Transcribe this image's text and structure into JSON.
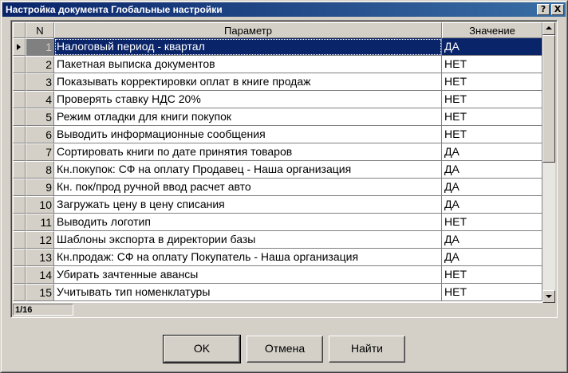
{
  "window": {
    "title": "Настройка документа Глобальные настройки",
    "help_label": "?",
    "close_label": "X"
  },
  "grid": {
    "columns": {
      "n": "N",
      "parameter": "Параметр",
      "value": "Значение"
    },
    "rows": [
      {
        "n": "1",
        "parameter": "Налоговый период - квартал",
        "value": "ДА"
      },
      {
        "n": "2",
        "parameter": "Пакетная выписка документов",
        "value": "НЕТ"
      },
      {
        "n": "3",
        "parameter": "Показывать корректировки оплат в книге продаж",
        "value": "НЕТ"
      },
      {
        "n": "4",
        "parameter": "Проверять ставку НДС 20%",
        "value": "НЕТ"
      },
      {
        "n": "5",
        "parameter": "Режим отладки для книги покупок",
        "value": "НЕТ"
      },
      {
        "n": "6",
        "parameter": "Выводить информационные сообщения",
        "value": "НЕТ"
      },
      {
        "n": "7",
        "parameter": "Сортировать книги по дате принятия товаров",
        "value": "ДА"
      },
      {
        "n": "8",
        "parameter": "Кн.покупок: СФ на оплату Продавец - Наша организация",
        "value": "ДА"
      },
      {
        "n": "9",
        "parameter": "Кн. пок/прод ручной ввод расчет авто",
        "value": "ДА"
      },
      {
        "n": "10",
        "parameter": "Загружать цену в цену списания",
        "value": "ДА"
      },
      {
        "n": "11",
        "parameter": "Выводить логотип",
        "value": "НЕТ"
      },
      {
        "n": "12",
        "parameter": "Шаблоны экспорта в директории базы",
        "value": "ДА"
      },
      {
        "n": "13",
        "parameter": "Кн.продаж: СФ на оплату Покупатель - Наша организация",
        "value": "ДА"
      },
      {
        "n": "14",
        "parameter": "Убирать зачтенные авансы",
        "value": "НЕТ"
      },
      {
        "n": "15",
        "parameter": "Учитывать тип номенклатуры",
        "value": "НЕТ"
      }
    ],
    "selected_index": 0
  },
  "status": {
    "record_counter": "1/16"
  },
  "buttons": {
    "ok": "OK",
    "cancel": "Отмена",
    "find": "Найти"
  },
  "colors": {
    "selection": "#0a246a",
    "face": "#d4d0c8",
    "title_gradient_start": "#0a246a",
    "title_gradient_end": "#3a6ea5"
  }
}
